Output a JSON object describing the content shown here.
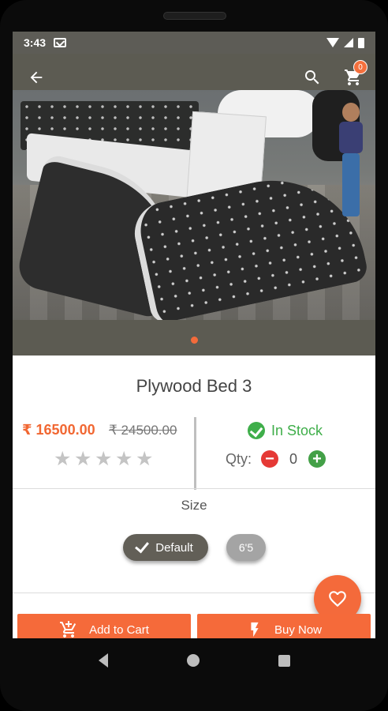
{
  "status": {
    "time": "3:43"
  },
  "appbar": {
    "cart_count": "0"
  },
  "product": {
    "title": "Plywood Bed 3",
    "price": "₹ 16500.00",
    "old_price": "₹ 24500.00",
    "rating": 0,
    "stars": [
      "★",
      "★",
      "★",
      "★",
      "★"
    ],
    "stock": "In Stock",
    "qty_label": "Qty:",
    "qty_value": "0",
    "image_index": 0
  },
  "size": {
    "label": "Size",
    "options": [
      {
        "label": "Default",
        "selected": true
      },
      {
        "label": "6'5",
        "selected": false
      }
    ]
  },
  "actions": {
    "add_to_cart": "Add to Cart",
    "buy_now": "Buy Now"
  },
  "colors": {
    "accent": "#f46a3b",
    "stock_green": "#3fae4a",
    "appbar": "#5d5c56"
  }
}
